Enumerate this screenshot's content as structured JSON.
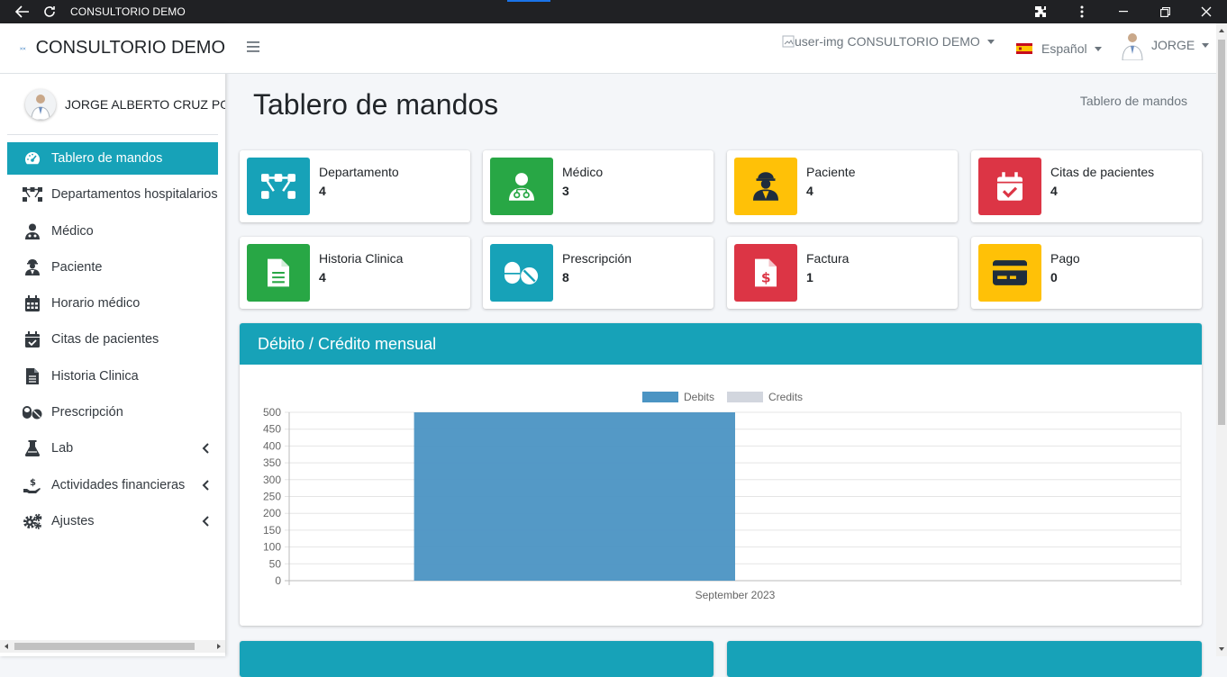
{
  "window": {
    "title": "CONSULTORIO DEMO"
  },
  "sidebar": {
    "brand": "CONSULTORIO DEMO",
    "user_name": "JORGE ALBERTO CRUZ POZO",
    "items": [
      {
        "label": "Tablero de mandos",
        "icon": "gauge-icon",
        "active": true
      },
      {
        "label": "Departamentos hospitalarios",
        "icon": "sitemap-icon"
      },
      {
        "label": "Médico",
        "icon": "doctor-icon"
      },
      {
        "label": "Paciente",
        "icon": "patient-icon"
      },
      {
        "label": "Horario médico",
        "icon": "calendar-icon"
      },
      {
        "label": "Citas de pacientes",
        "icon": "calendar-check-icon"
      },
      {
        "label": "Historia Clinica",
        "icon": "file-icon"
      },
      {
        "label": "Prescripción",
        "icon": "pills-icon"
      },
      {
        "label": "Lab",
        "icon": "flask-icon",
        "submenu": true
      },
      {
        "label": "Actividades financieras",
        "icon": "hand-dollar-icon",
        "submenu": true
      },
      {
        "label": "Ajustes",
        "icon": "cogs-icon",
        "submenu": true
      }
    ]
  },
  "topbar": {
    "clinic_alt": "user-img",
    "clinic_name": "CONSULTORIO DEMO",
    "language": "Español",
    "user": "JORGE"
  },
  "page": {
    "title": "Tablero de mandos",
    "breadcrumb": "Tablero de mandos"
  },
  "stats": [
    {
      "label": "Departamento",
      "value": "4",
      "color": "#17a2b8",
      "icon": "sitemap-icon"
    },
    {
      "label": "Médico",
      "value": "3",
      "color": "#28a745",
      "icon": "doctor-icon"
    },
    {
      "label": "Paciente",
      "value": "4",
      "color": "#ffc107",
      "icon": "patient-icon"
    },
    {
      "label": "Citas de pacientes",
      "value": "4",
      "color": "#dc3545",
      "icon": "calendar-check-icon"
    },
    {
      "label": "Historia Clinica",
      "value": "4",
      "color": "#28a745",
      "icon": "file-icon"
    },
    {
      "label": "Prescripción",
      "value": "8",
      "color": "#17a2b8",
      "icon": "pills-icon"
    },
    {
      "label": "Factura",
      "value": "1",
      "color": "#dc3545",
      "icon": "invoice-icon"
    },
    {
      "label": "Pago",
      "value": "0",
      "color": "#ffc107",
      "icon": "credit-card-icon"
    }
  ],
  "card": {
    "title": "Débito / Crédito mensual"
  },
  "chart_data": {
    "type": "bar",
    "categories": [
      "September 2023"
    ],
    "series": [
      {
        "name": "Debits",
        "values": [
          500
        ],
        "color": "#4b94c3"
      },
      {
        "name": "Credits",
        "values": [
          0
        ],
        "color": "#d2d6de"
      }
    ],
    "ylim": [
      0,
      500
    ],
    "yticks": [
      0,
      50,
      100,
      150,
      200,
      250,
      300,
      350,
      400,
      450,
      500
    ],
    "legend": "top-center",
    "grid": true
  },
  "colors": {
    "accent": "#17a2b8",
    "sidebar_active": "#17a2b8"
  }
}
